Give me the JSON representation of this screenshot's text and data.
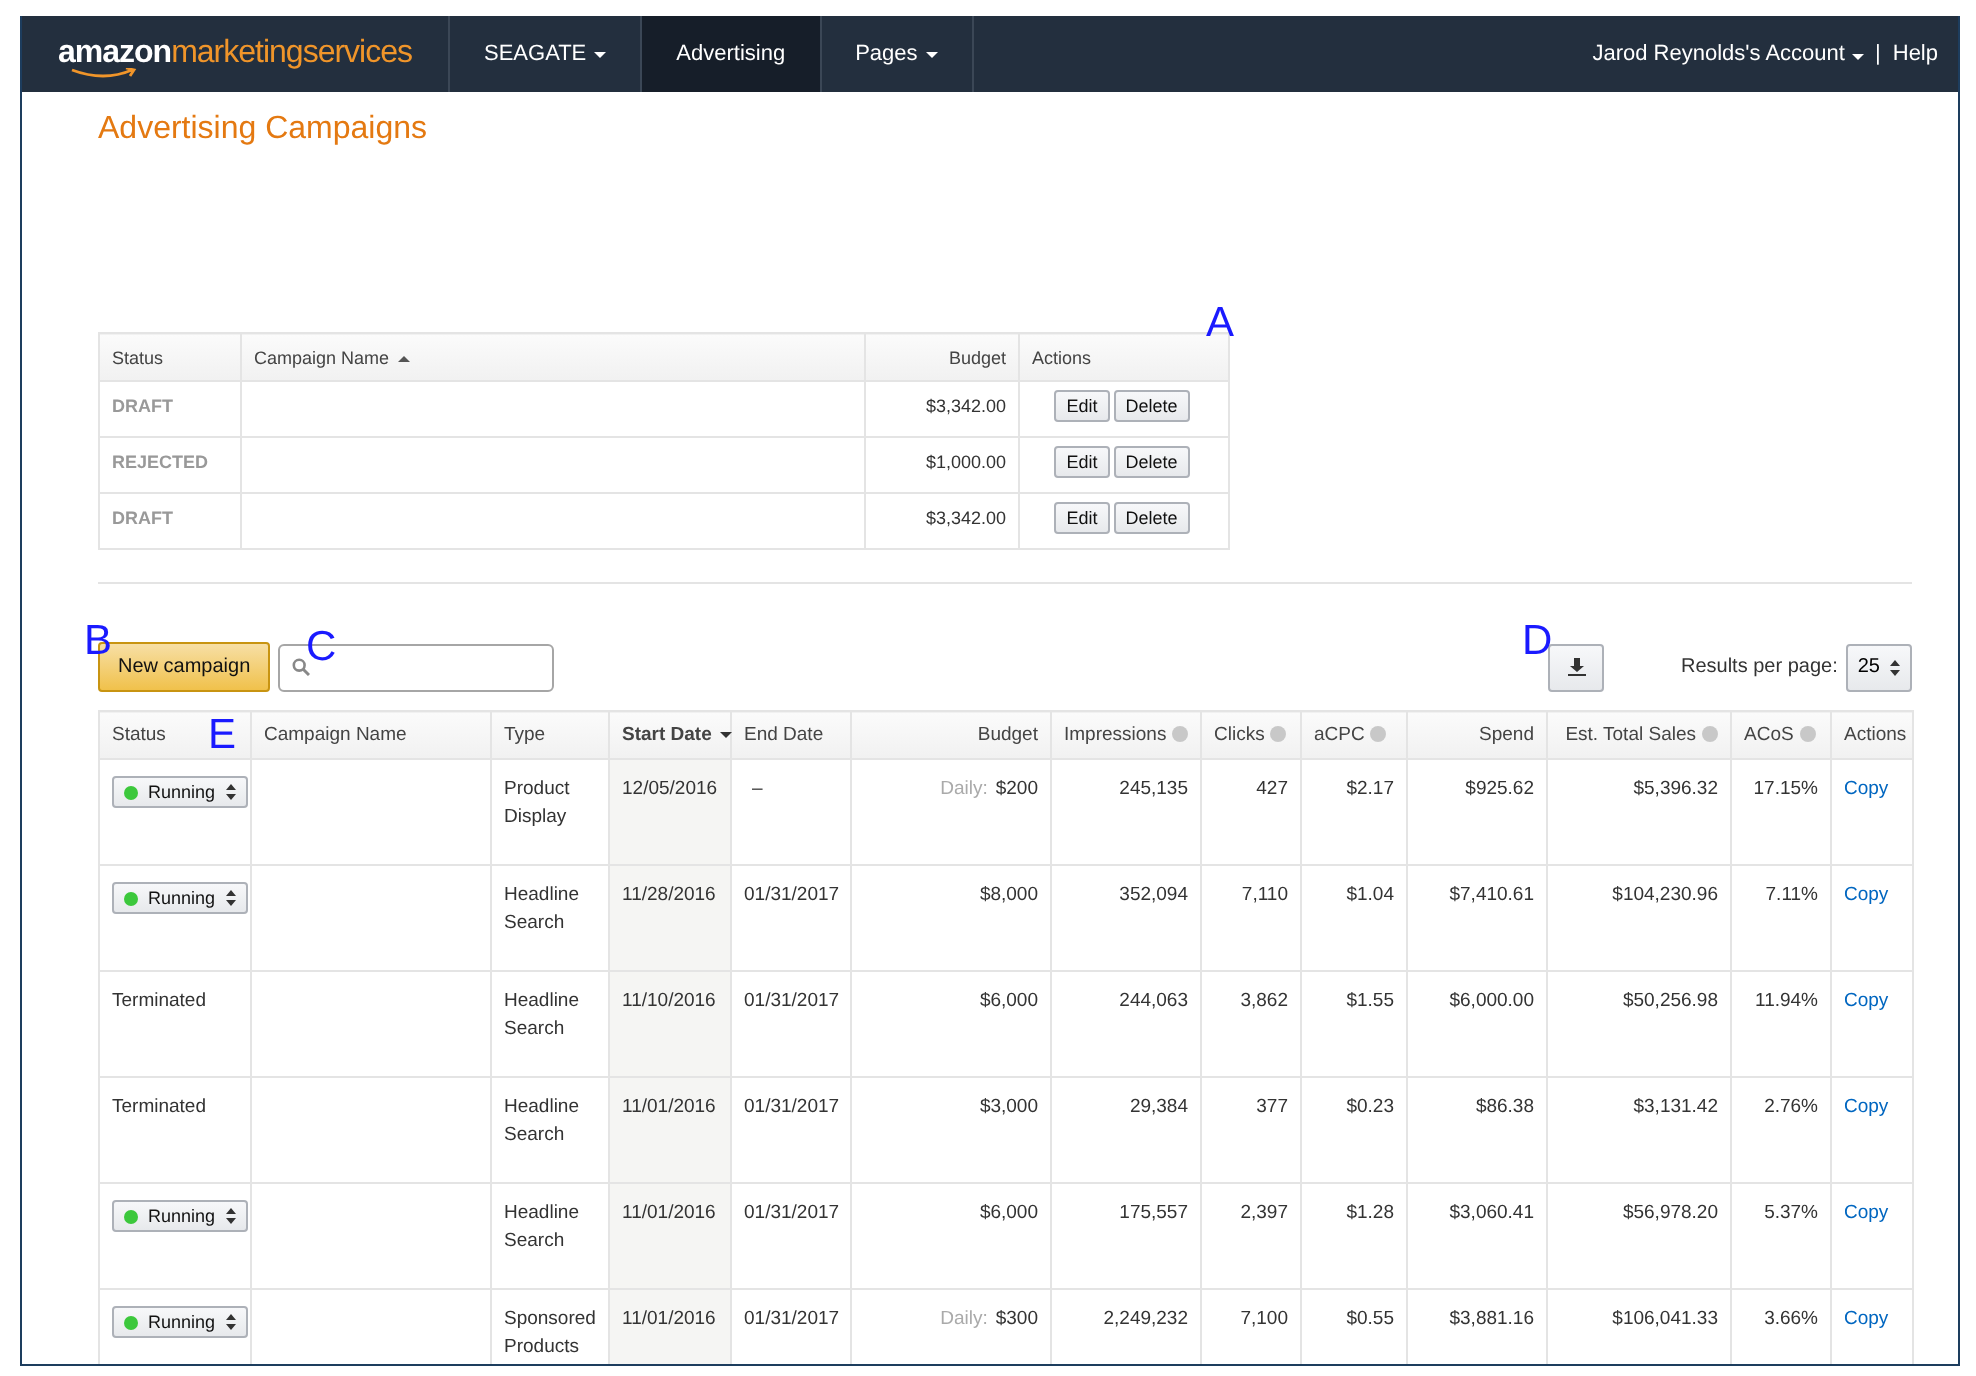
{
  "nav": {
    "logo": {
      "first": "amazon",
      "second": "marketingservices"
    },
    "items": [
      {
        "label": "SEAGATE",
        "dropdown": true,
        "selected": false
      },
      {
        "label": "Advertising",
        "dropdown": false,
        "selected": true
      },
      {
        "label": "Pages",
        "dropdown": true,
        "selected": false
      }
    ],
    "account": "Jarod Reynolds's Account",
    "separator": "|",
    "help": "Help"
  },
  "title": "Advertising Campaigns",
  "annotations": [
    "A",
    "B",
    "C",
    "D",
    "E"
  ],
  "drafts": {
    "columns": [
      {
        "label": "Status",
        "sorted": false
      },
      {
        "label": "Campaign Name",
        "sorted": true,
        "ascending": true
      },
      {
        "label": "Budget",
        "sorted": false
      },
      {
        "label": "Actions",
        "sorted": false
      }
    ],
    "rows": [
      {
        "status": "DRAFT",
        "budget": "$3,342.00",
        "actions": [
          "Edit",
          "Delete"
        ]
      },
      {
        "status": "REJECTED",
        "budget": "$1,000.00",
        "actions": [
          "Edit",
          "Delete"
        ]
      },
      {
        "status": "DRAFT",
        "budget": "$3,342.00",
        "actions": [
          "Edit",
          "Delete"
        ]
      }
    ]
  },
  "toolbar": {
    "new_button": "New campaign",
    "results_label": "Results per page:",
    "results_value": "25"
  },
  "campaigns": {
    "columns": [
      {
        "label": "Status",
        "sorted": false,
        "help": false
      },
      {
        "label": "Campaign Name",
        "sorted": false,
        "help": false
      },
      {
        "label": "Type",
        "sorted": false,
        "help": false
      },
      {
        "label": "Start Date",
        "sorted": true,
        "ascending": false,
        "help": false
      },
      {
        "label": "End Date",
        "sorted": false,
        "help": false
      },
      {
        "label": "Budget",
        "sorted": false,
        "help": false
      },
      {
        "label": "Impressions",
        "sorted": false,
        "help": true
      },
      {
        "label": "Clicks",
        "sorted": false,
        "help": true
      },
      {
        "label": "aCPC",
        "sorted": false,
        "help": true
      },
      {
        "label": "Spend",
        "sorted": false,
        "help": false
      },
      {
        "label": "Est. Total Sales",
        "sorted": false,
        "help": true
      },
      {
        "label": "ACoS",
        "sorted": false,
        "help": true
      },
      {
        "label": "Actions",
        "sorted": false,
        "help": false
      }
    ],
    "rows": [
      {
        "status": {
          "kind": "select",
          "label": "Running",
          "color": "#3cc83c"
        },
        "type": "Product Display",
        "start": "12/05/2016",
        "end": "–",
        "budget_prefix": "Daily:",
        "budget": "$200",
        "impressions": "245,135",
        "clicks": "427",
        "acpc": "$2.17",
        "spend": "$925.62",
        "sales": "$5,396.32",
        "acos": "17.15%",
        "action": "Copy"
      },
      {
        "status": {
          "kind": "select",
          "label": "Running",
          "color": "#3cc83c"
        },
        "type": "Headline Search",
        "start": "11/28/2016",
        "end": "01/31/2017",
        "budget": "$8,000",
        "impressions": "352,094",
        "clicks": "7,110",
        "acpc": "$1.04",
        "spend": "$7,410.61",
        "sales": "$104,230.96",
        "acos": "7.11%",
        "action": "Copy"
      },
      {
        "status": {
          "kind": "text",
          "label": "Terminated"
        },
        "type": "Headline Search",
        "start": "11/10/2016",
        "end": "01/31/2017",
        "budget": "$6,000",
        "impressions": "244,063",
        "clicks": "3,862",
        "acpc": "$1.55",
        "spend": "$6,000.00",
        "sales": "$50,256.98",
        "acos": "11.94%",
        "action": "Copy"
      },
      {
        "status": {
          "kind": "text",
          "label": "Terminated"
        },
        "type": "Headline Search",
        "start": "11/01/2016",
        "end": "01/31/2017",
        "budget": "$3,000",
        "impressions": "29,384",
        "clicks": "377",
        "acpc": "$0.23",
        "spend": "$86.38",
        "sales": "$3,131.42",
        "acos": "2.76%",
        "action": "Copy"
      },
      {
        "status": {
          "kind": "select",
          "label": "Running",
          "color": "#3cc83c"
        },
        "type": "Headline Search",
        "start": "11/01/2016",
        "end": "01/31/2017",
        "budget": "$6,000",
        "impressions": "175,557",
        "clicks": "2,397",
        "acpc": "$1.28",
        "spend": "$3,060.41",
        "sales": "$56,978.20",
        "acos": "5.37%",
        "action": "Copy"
      },
      {
        "status": {
          "kind": "select",
          "label": "Running",
          "color": "#3cc83c"
        },
        "type": "Sponsored Products",
        "start": "11/01/2016",
        "end": "01/31/2017",
        "budget_prefix": "Daily:",
        "budget": "$300",
        "impressions": "2,249,232",
        "clicks": "7,100",
        "acpc": "$0.55",
        "spend": "$3,881.16",
        "sales": "$106,041.33",
        "acos": "3.66%",
        "action": "Copy"
      }
    ]
  }
}
